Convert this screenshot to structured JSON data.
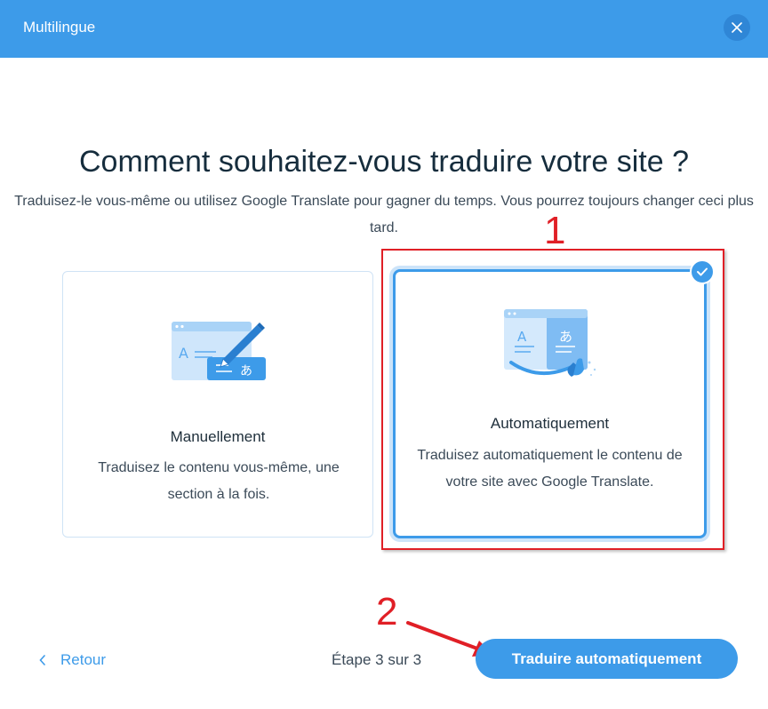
{
  "header": {
    "title": "Multilingue",
    "close_icon": "close-icon"
  },
  "main": {
    "heading": "Comment souhaitez-vous traduire votre site ?",
    "subtitle": "Traduisez-le vous-même ou utilisez Google Translate pour gagner du temps. Vous pourrez toujours changer ceci plus tard."
  },
  "options": [
    {
      "title": "Manuellement",
      "description": "Traduisez le contenu vous-même, une section à la fois.",
      "icon": "manual-translate-illustration",
      "selected": false
    },
    {
      "title": "Automatiquement",
      "description": "Traduisez automatiquement le contenu de votre site avec Google Translate.",
      "icon": "auto-translate-illustration",
      "selected": true
    }
  ],
  "annotations": {
    "first": "1",
    "second": "2"
  },
  "footer": {
    "back_label": "Retour",
    "step_text": "Étape 3 sur 3",
    "primary_label": "Traduire automatiquement"
  },
  "colors": {
    "accent": "#3d9be9",
    "annotation_red": "#e01f26",
    "heading": "#162d3d"
  }
}
